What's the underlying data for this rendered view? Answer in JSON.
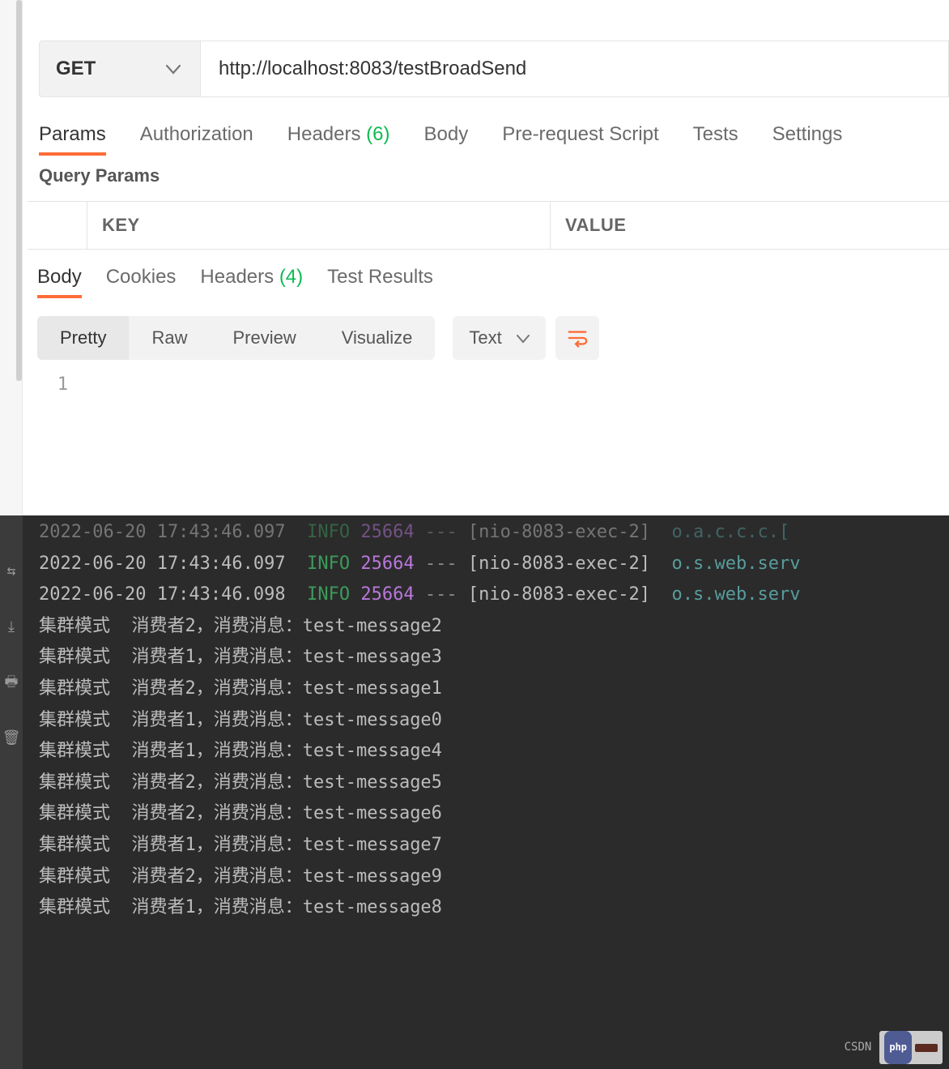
{
  "request": {
    "method": "GET",
    "url": "http://localhost:8083/testBroadSend"
  },
  "req_tabs": {
    "items": [
      {
        "label": "Params",
        "active": true
      },
      {
        "label": "Authorization"
      },
      {
        "label": "Headers",
        "count": "(6)"
      },
      {
        "label": "Body"
      },
      {
        "label": "Pre-request Script"
      },
      {
        "label": "Tests"
      },
      {
        "label": "Settings"
      }
    ]
  },
  "query_params": {
    "title": "Query Params",
    "key_header": "KEY",
    "value_header": "VALUE"
  },
  "resp_tabs": {
    "items": [
      {
        "label": "Body",
        "active": true
      },
      {
        "label": "Cookies"
      },
      {
        "label": "Headers",
        "count": "(4)"
      },
      {
        "label": "Test Results"
      }
    ]
  },
  "view_seg": {
    "items": [
      {
        "label": "Pretty",
        "active": true
      },
      {
        "label": "Raw"
      },
      {
        "label": "Preview"
      },
      {
        "label": "Visualize"
      }
    ]
  },
  "type_select": {
    "label": "Text"
  },
  "response_body": {
    "line1_num": "1",
    "line1_text": ""
  },
  "console": {
    "logs": [
      {
        "ts": "2022-06-20 17:43:46.097",
        "lvl": "INFO",
        "pid": "25664",
        "thread": "[nio-8083-exec-2]",
        "src": "o.a.c.c.c.["
      },
      {
        "ts": "2022-06-20 17:43:46.097",
        "lvl": "INFO",
        "pid": "25664",
        "thread": "[nio-8083-exec-2]",
        "src": "o.s.web.serv"
      },
      {
        "ts": "2022-06-20 17:43:46.098",
        "lvl": "INFO",
        "pid": "25664",
        "thread": "[nio-8083-exec-2]",
        "src": "o.s.web.serv"
      }
    ],
    "messages": [
      "集群模式  消费者2，消费消息：test-message2",
      "集群模式  消费者1，消费消息：test-message3",
      "集群模式  消费者2，消费消息：test-message1",
      "集群模式  消费者1，消费消息：test-message0",
      "集群模式  消费者1，消费消息：test-message4",
      "集群模式  消费者2，消费消息：test-message5",
      "集群模式  消费者2，消费消息：test-message6",
      "集群模式  消费者1，消费消息：test-message7",
      "集群模式  消费者2，消费消息：test-message9",
      "集群模式  消费者1，消费消息：test-message8"
    ]
  },
  "watermark": {
    "text": "CSDN",
    "php": "php"
  }
}
